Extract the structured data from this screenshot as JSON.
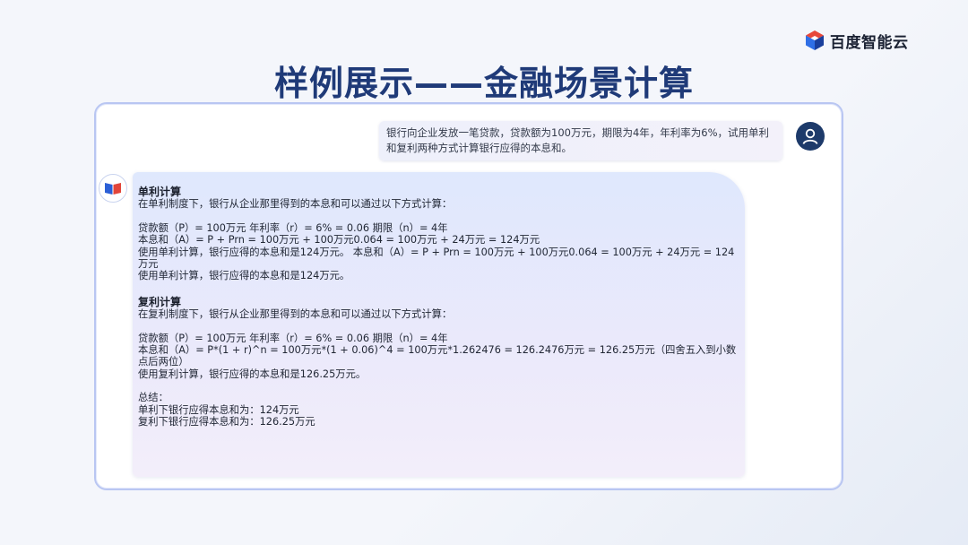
{
  "brand": {
    "name": "百度智能云",
    "icon": "baidu-cloud-cube-icon"
  },
  "title": "样例展示——金融场景计算",
  "user_message": "银行向企业发放一笔贷款，贷款额为100万元，期限为4年，年利率为6%，试用单利和复利两种方式计算银行应得的本息和。",
  "bot": {
    "simple": {
      "heading": "单利计算",
      "intro": "在单利制度下，银行从企业那里得到的本息和可以通过以下方式计算：",
      "params": "贷款额（P）= 100万元 年利率（r）= 6% = 0.06 期限（n）= 4年",
      "formula": "本息和（A）= P + Prn = 100万元 + 100万元0.064 = 100万元 + 24万元 = 124万元",
      "usage_repeat": "使用单利计算，银行应得的本息和是124万元。 本息和（A）= P + Prn = 100万元 + 100万元0.064 = 100万元 + 24万元 = 124万元",
      "result": "使用单利计算，银行应得的本息和是124万元。"
    },
    "compound": {
      "heading": "复利计算",
      "intro": "在复利制度下，银行从企业那里得到的本息和可以通过以下方式计算：",
      "params": "贷款额（P）= 100万元 年利率（r）= 6% = 0.06 期限（n）= 4年",
      "formula": "本息和（A）= P*(1 + r)^n = 100万元*(1 + 0.06)^4 = 100万元*1.262476 = 126.2476万元 = 126.25万元（四舍五入到小数点后两位）",
      "result": "使用复利计算，银行应得的本息和是126.25万元。"
    },
    "summary": {
      "label": "总结：",
      "simple": "单利下银行应得本息和为：124万元",
      "compound": "复利下银行应得本息和为：126.25万元"
    }
  },
  "icons": {
    "user_avatar": "user-avatar-icon",
    "bot_avatar": "book-logo-icon"
  },
  "colors": {
    "title": "#1f3a78",
    "frame_border": "#b9c6f2",
    "avatar": "#1d3a6a"
  }
}
